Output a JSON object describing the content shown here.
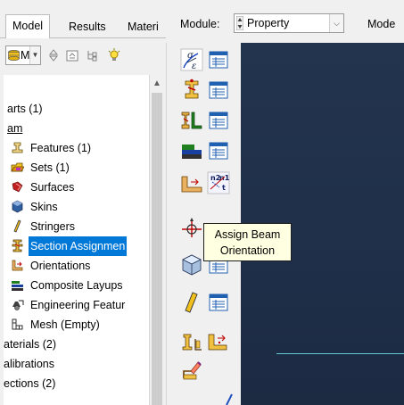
{
  "left_panel": {
    "tabs": [
      {
        "label": "Model",
        "selected": true
      },
      {
        "label": "Results",
        "selected": false
      },
      {
        "label": "Materi",
        "selected": false
      }
    ],
    "model_combo": {
      "value": "M"
    },
    "tree": [
      {
        "label": "arts (1)",
        "level": 0,
        "icon": "none"
      },
      {
        "label": "am",
        "level": 0,
        "icon": "none",
        "underlined": true
      },
      {
        "label": "Features (1)",
        "level": 1,
        "icon": "features-icon"
      },
      {
        "label": "Sets (1)",
        "level": 1,
        "icon": "sets-icon"
      },
      {
        "label": "Surfaces",
        "level": 1,
        "icon": "surfaces-icon"
      },
      {
        "label": "Skins",
        "level": 1,
        "icon": "skins-icon"
      },
      {
        "label": "Stringers",
        "level": 1,
        "icon": "stringers-icon"
      },
      {
        "label": "Section Assignmen",
        "level": 1,
        "icon": "section-assignment-icon",
        "selected": true
      },
      {
        "label": "Orientations",
        "level": 1,
        "icon": "orientations-icon"
      },
      {
        "label": "Composite Layups",
        "level": 1,
        "icon": "composite-layups-icon"
      },
      {
        "label": "Engineering Featur",
        "level": 1,
        "icon": "engineering-features-icon"
      },
      {
        "label": "Mesh (Empty)",
        "level": 1,
        "icon": "mesh-icon"
      },
      {
        "label": "aterials (2)",
        "level": 0,
        "icon": "none"
      },
      {
        "label": "alibrations",
        "level": 0,
        "icon": "none"
      },
      {
        "label": "ections (2)",
        "level": 0,
        "icon": "none"
      }
    ]
  },
  "topbar": {
    "module_label": "Module:",
    "module_value": "Property",
    "model_label": "Mode"
  },
  "toolbox": {
    "tools": [
      "create-material-icon",
      "material-manager-icon",
      "create-section-icon",
      "section-manager-icon",
      "create-profile-icon",
      "profile-manager-icon",
      "assign-section-icon",
      "section-assignment-manager-icon",
      "assign-material-orientation-icon",
      "assign-rebar-reference-icon",
      "assign-beam-orientation-icon",
      "create-composite-layup-icon",
      "composite-layup-manager-icon",
      "skin-icon",
      "skin-manager-icon",
      "special-inertia-icon",
      "assign-springs-icon",
      "edit-icon"
    ]
  },
  "tooltip": {
    "line1": "Assign Beam",
    "line2": "Orientation"
  },
  "colors": {
    "selection": "#0078d7",
    "viewport_bg": "#22324c",
    "beam_line": "#5fc9d7",
    "tooltip_bg": "#ffffe1"
  }
}
